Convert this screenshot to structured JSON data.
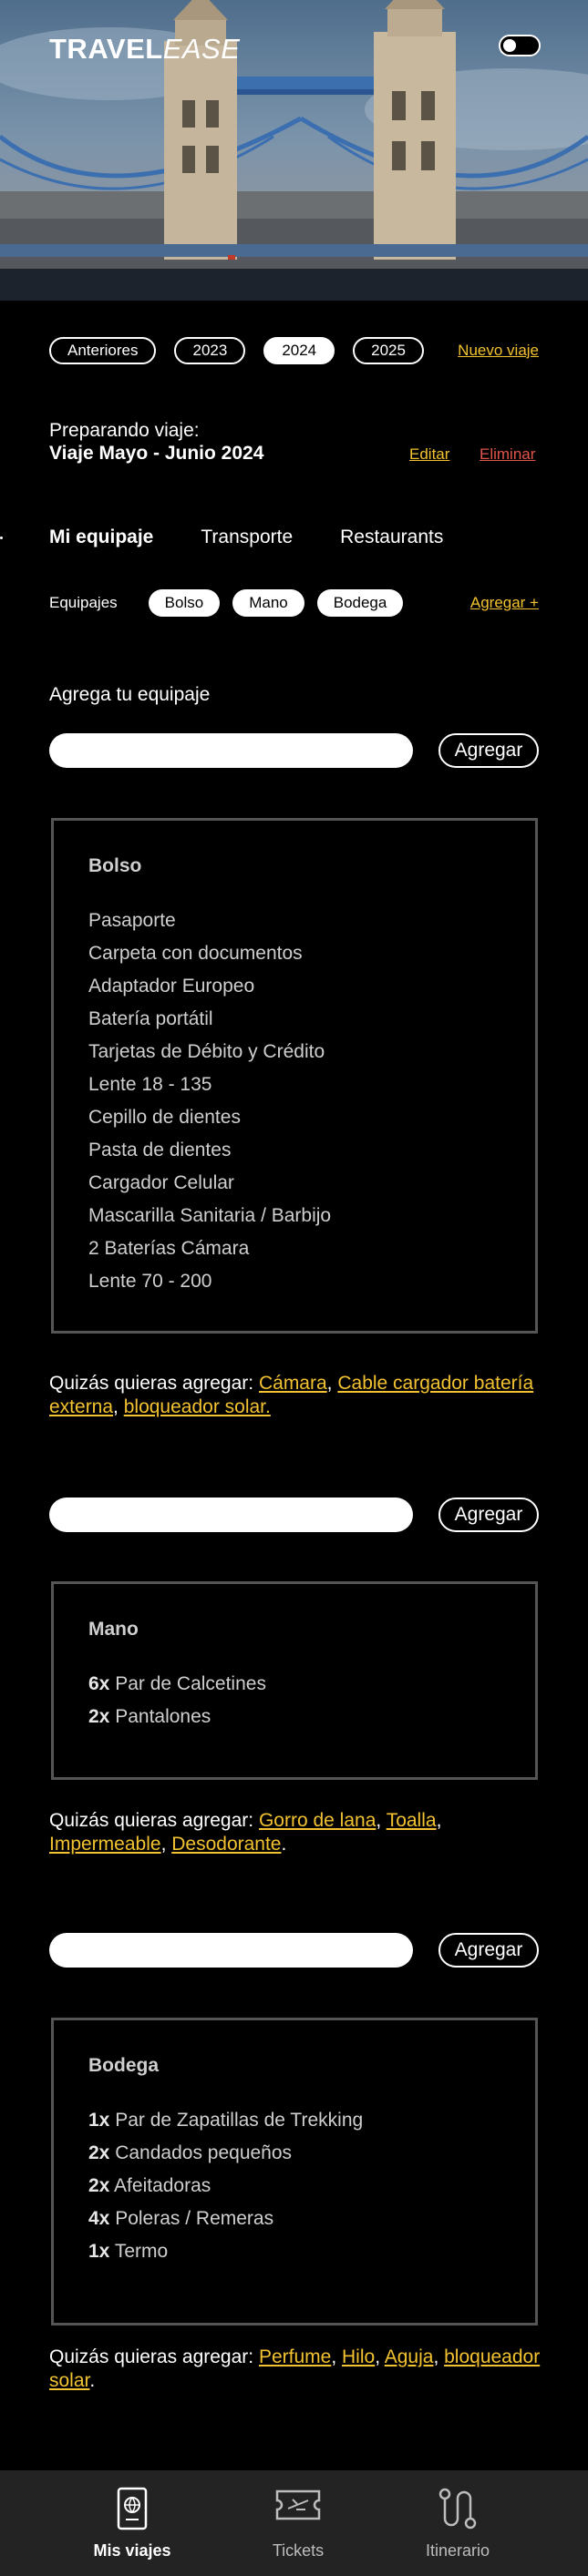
{
  "header": {
    "logo_bold": "TRAVEL",
    "logo_italic": "EASE",
    "icons": [
      "gear-icon",
      "bell-icon",
      "toggle-switch"
    ]
  },
  "years": {
    "items": [
      "Anteriores",
      "2023",
      "2024",
      "2025"
    ],
    "selected": "2024",
    "new_trip": "Nuevo viaje"
  },
  "trip": {
    "label": "Preparando viaje:",
    "title": "Viaje Mayo - Junio 2024",
    "edit": "Editar",
    "delete": "Eliminar"
  },
  "tabs": [
    "Mi equipaje",
    "Transporte",
    "Restaurants"
  ],
  "luggage": {
    "label": "Equipajes",
    "chips": [
      "Bolso",
      "Mano",
      "Bodega"
    ],
    "add_link": "Agregar +",
    "add_title": "Agrega tu equipaje",
    "add_button": "Agregar"
  },
  "boxes": [
    {
      "title": "Bolso",
      "items": [
        {
          "qty": "",
          "text": "Pasaporte"
        },
        {
          "qty": "",
          "text": "Carpeta con documentos"
        },
        {
          "qty": "",
          "text": "Adaptador Europeo"
        },
        {
          "qty": "",
          "text": "Batería portátil"
        },
        {
          "qty": "",
          "text": "Tarjetas de Débito y Crédito"
        },
        {
          "qty": "",
          "text": "Lente 18 - 135"
        },
        {
          "qty": "",
          "text": "Cepillo de dientes"
        },
        {
          "qty": "",
          "text": "Pasta de dientes"
        },
        {
          "qty": "",
          "text": "Cargador Celular"
        },
        {
          "qty": "",
          "text": "Mascarilla Sanitaria / Barbijo"
        },
        {
          "qty": "",
          "text": "2 Baterías Cámara"
        },
        {
          "qty": "",
          "text": "Lente 70 - 200"
        }
      ],
      "suggest_prefix": "Quizás quieras agregar:",
      "suggestions": [
        "Cámara",
        "Cable cargador batería externa",
        "bloqueador solar."
      ]
    },
    {
      "title": "Mano",
      "items": [
        {
          "qty": "6x",
          "text": "Par de Calcetines"
        },
        {
          "qty": "2x",
          "text": "Pantalones"
        }
      ],
      "suggest_prefix": "Quizás quieras agregar:",
      "suggestions": [
        "Gorro de lana",
        "Toalla",
        "Impermeable",
        "Desodorante"
      ]
    },
    {
      "title": "Bodega",
      "items": [
        {
          "qty": "1x",
          "text": "Par de Zapatillas de Trekking"
        },
        {
          "qty": "2x",
          "text": "Candados pequeños"
        },
        {
          "qty": "2x",
          "text": "Afeitadoras"
        },
        {
          "qty": "4x",
          "text": "Poleras / Remeras"
        },
        {
          "qty": "1x",
          "text": "Termo"
        }
      ],
      "suggest_prefix": "Quizás quieras agregar:",
      "suggestions": [
        "Perfume",
        "Hilo",
        "Aguja",
        "bloqueador solar"
      ]
    }
  ],
  "bottom_nav": [
    {
      "label": "Mis viajes",
      "icon": "passport-icon",
      "active": true
    },
    {
      "label": "Tickets",
      "icon": "ticket-icon",
      "active": false
    },
    {
      "label": "Itinerario",
      "icon": "route-icon",
      "active": false
    }
  ],
  "colors": {
    "accent_link": "#f2c230",
    "danger_link": "#e0554a",
    "background": "#000000",
    "nav_background": "#232323"
  }
}
